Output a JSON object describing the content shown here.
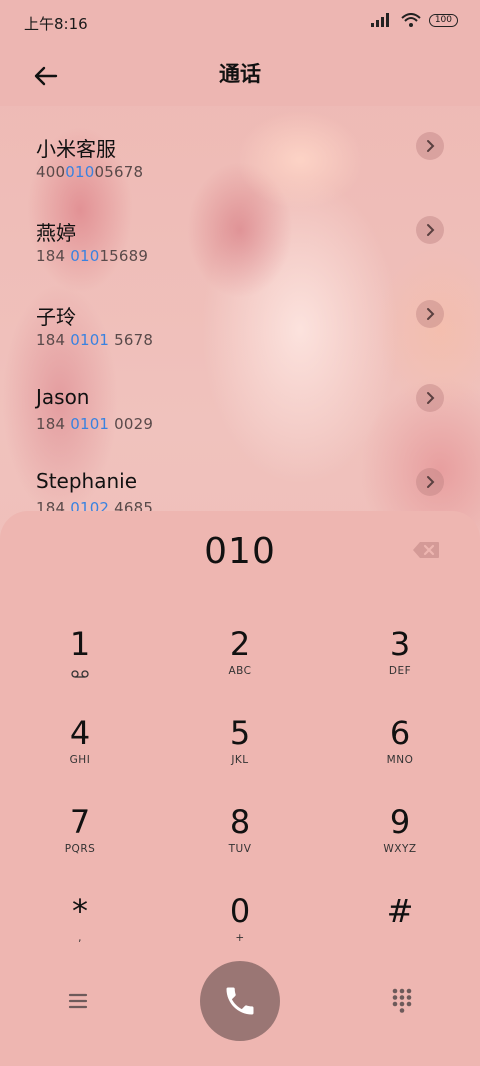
{
  "status_bar": {
    "time": "上午8:16",
    "battery": "100"
  },
  "header": {
    "title": "通话"
  },
  "contacts": [
    {
      "name": "小米客服",
      "number_pre": "400",
      "number_hl": "010",
      "number_post": "05678"
    },
    {
      "name": "燕婷",
      "number_pre": "184 ",
      "number_hl": "010",
      "number_post": "15689"
    },
    {
      "name": "子玲",
      "number_pre": "184 ",
      "number_hl": "0101",
      "number_post": " 5678"
    },
    {
      "name": "Jason",
      "number_pre": "184 ",
      "number_hl": "0101",
      "number_post": " 0029"
    },
    {
      "name": "Stephanie",
      "number_pre": "184 ",
      "number_hl": "0102",
      "number_post": " 4685"
    }
  ],
  "dialer": {
    "input": "010",
    "keys": [
      {
        "digit": "1",
        "letters": ""
      },
      {
        "digit": "2",
        "letters": "ABC"
      },
      {
        "digit": "3",
        "letters": "DEF"
      },
      {
        "digit": "4",
        "letters": "GHI"
      },
      {
        "digit": "5",
        "letters": "JKL"
      },
      {
        "digit": "6",
        "letters": "MNO"
      },
      {
        "digit": "7",
        "letters": "PQRS"
      },
      {
        "digit": "8",
        "letters": "TUV"
      },
      {
        "digit": "9",
        "letters": "WXYZ"
      },
      {
        "digit": "*",
        "letters": ","
      },
      {
        "digit": "0",
        "letters": "+"
      },
      {
        "digit": "#",
        "letters": ""
      }
    ]
  },
  "colors": {
    "accent_highlight": "#3a82e0",
    "call_button": "#9a7674",
    "panel": "#eeb6b1"
  },
  "icons": {
    "back": "arrow-left-icon",
    "info": "chevron-right-icon",
    "backspace": "backspace-icon",
    "voicemail": "voicemail-icon",
    "call": "phone-icon",
    "menu": "menu-icon",
    "dialpad": "dialpad-icon"
  }
}
